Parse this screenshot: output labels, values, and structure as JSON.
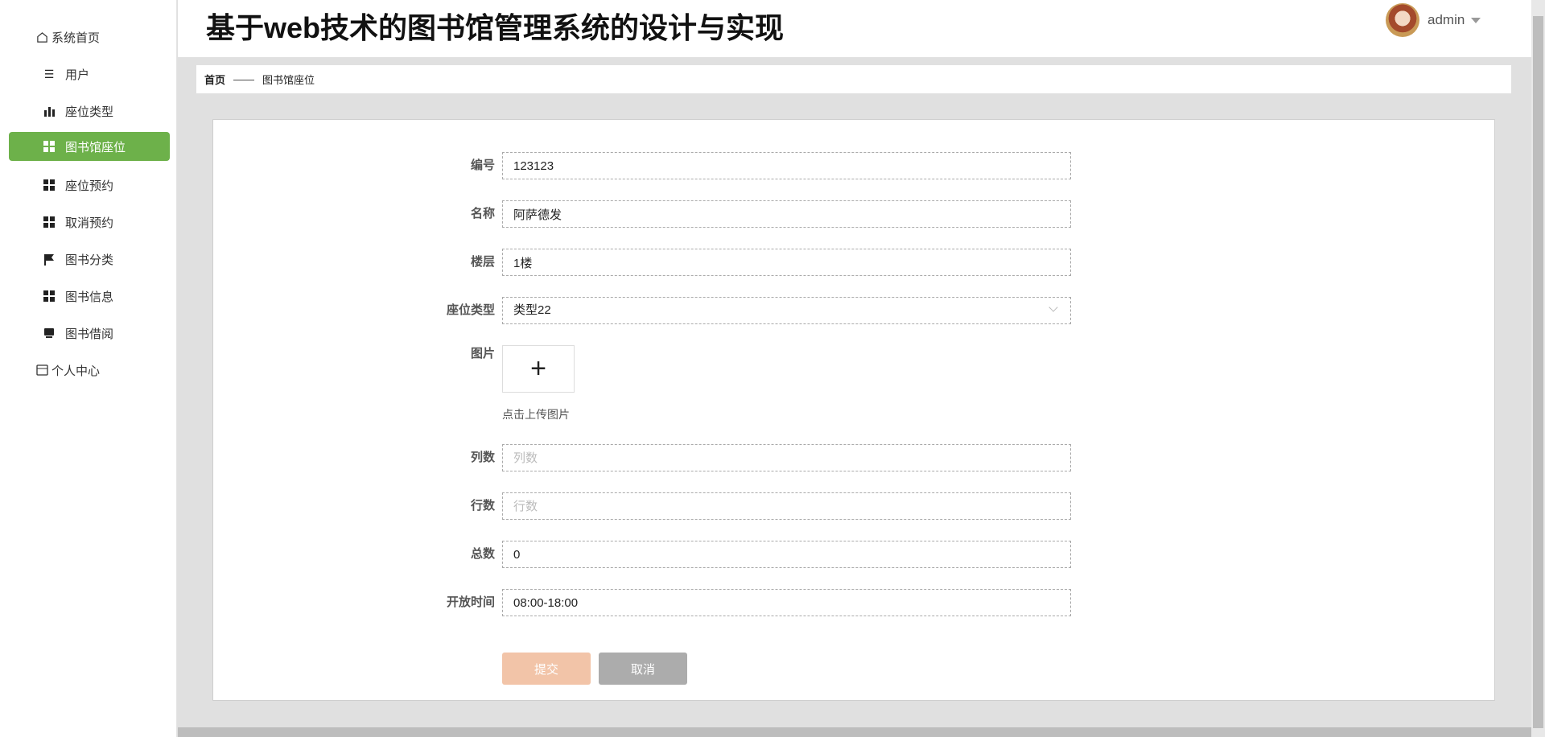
{
  "header": {
    "title": "基于web技术的图书馆管理系统的设计与实现",
    "user": "admin"
  },
  "sidebar": {
    "items": [
      {
        "label": "系统首页",
        "icon": "home-icon"
      },
      {
        "label": "用户",
        "icon": "list-icon"
      },
      {
        "label": "座位类型",
        "icon": "bar-chart-icon"
      },
      {
        "label": "图书馆座位",
        "icon": "grid-icon",
        "active": true
      },
      {
        "label": "座位预约",
        "icon": "grid-icon"
      },
      {
        "label": "取消预约",
        "icon": "grid-icon"
      },
      {
        "label": "图书分类",
        "icon": "flag-icon"
      },
      {
        "label": "图书信息",
        "icon": "grid-icon"
      },
      {
        "label": "图书借阅",
        "icon": "printer-icon"
      },
      {
        "label": "个人中心",
        "icon": "card-icon"
      }
    ]
  },
  "breadcrumb": {
    "home": "首页",
    "sep": "——",
    "current": "图书馆座位"
  },
  "form": {
    "number": {
      "label": "编号",
      "value": "123123"
    },
    "name": {
      "label": "名称",
      "value": "阿萨德发"
    },
    "floor": {
      "label": "楼层",
      "value": "1楼"
    },
    "seat_type": {
      "label": "座位类型",
      "value": "类型22"
    },
    "image": {
      "label": "图片",
      "plus": "+",
      "hint": "点击上传图片"
    },
    "columns": {
      "label": "列数",
      "placeholder": "列数"
    },
    "rows": {
      "label": "行数",
      "placeholder": "行数"
    },
    "total": {
      "label": "总数",
      "value": "0"
    },
    "open_time": {
      "label": "开放时间",
      "value": "08:00-18:00"
    },
    "submit": "提交",
    "cancel": "取消"
  },
  "colors": {
    "accent": "#6db14a",
    "submit": "#f2c4a8",
    "cancel": "#acacac"
  }
}
